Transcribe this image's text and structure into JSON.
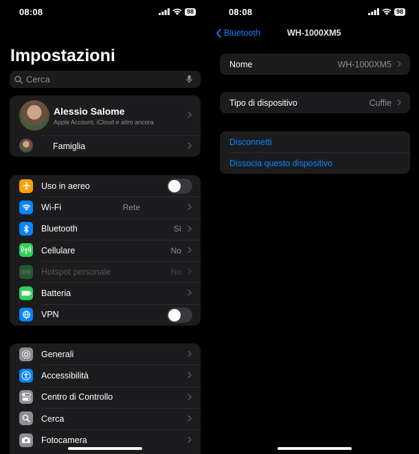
{
  "left": {
    "status": {
      "time": "08:08",
      "battery": "98"
    },
    "title": "Impostazioni",
    "search": {
      "placeholder": "Cerca"
    },
    "profile": {
      "name": "Alessio Salome",
      "subtitle": "Apple Account, iCloud e altro ancora",
      "family": "Famiglia"
    },
    "connectivity": [
      {
        "label": "Uso in aereo",
        "icon": "airplane-icon",
        "color": "#ff9f0a",
        "toggle": false
      },
      {
        "label": "Wi-Fi",
        "icon": "wifi-icon",
        "color": "#0a84ff",
        "value": "Rete"
      },
      {
        "label": "Bluetooth",
        "icon": "bluetooth-icon",
        "color": "#0a84ff",
        "value": "Sì"
      },
      {
        "label": "Cellulare",
        "icon": "cellular-icon",
        "color": "#30d158",
        "value": "No"
      },
      {
        "label": "Hotspot personale",
        "icon": "hotspot-icon",
        "color": "#30d158",
        "value": "No",
        "disabled": true
      },
      {
        "label": "Batteria",
        "icon": "battery-icon",
        "color": "#30d158"
      },
      {
        "label": "VPN",
        "icon": "vpn-icon",
        "color": "#0a84ff",
        "toggle": false
      }
    ],
    "general": [
      {
        "label": "Generali",
        "icon": "gear-icon",
        "color": "#8e8e93"
      },
      {
        "label": "Accessibilità",
        "icon": "accessibility-icon",
        "color": "#0a84ff"
      },
      {
        "label": "Centro di Controllo",
        "icon": "control-center-icon",
        "color": "#8e8e93"
      },
      {
        "label": "Cerca",
        "icon": "search-icon",
        "color": "#8e8e93"
      },
      {
        "label": "Fotocamera",
        "icon": "camera-icon",
        "color": "#8e8e93"
      }
    ]
  },
  "right": {
    "status": {
      "time": "08:08",
      "battery": "98"
    },
    "nav": {
      "back_label": "Bluetooth",
      "title": "WH-1000XM5"
    },
    "name_row": {
      "label": "Nome",
      "value": "WH-1000XM5"
    },
    "type_row": {
      "label": "Tipo di dispositivo",
      "value": "Cuffie"
    },
    "actions": {
      "disconnect": "Disconnetti",
      "forget": "Dissocia questo dispositivo"
    }
  }
}
